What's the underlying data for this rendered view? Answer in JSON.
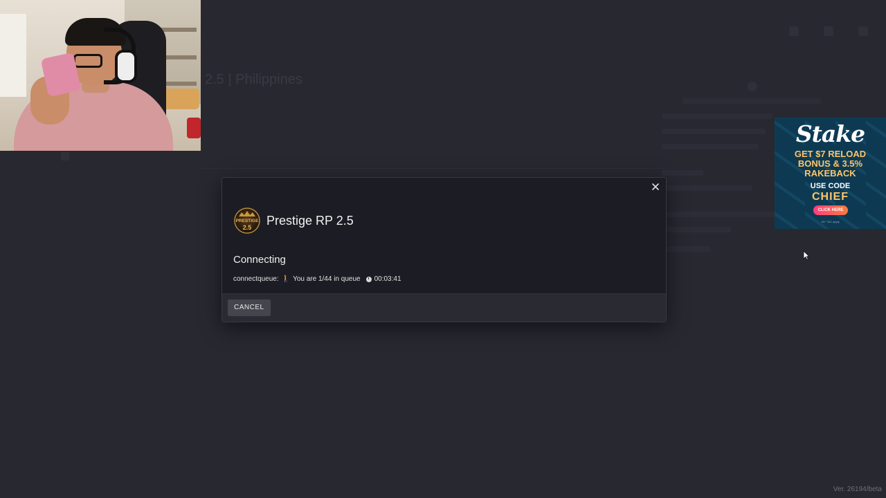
{
  "background": {
    "server_title": "2.5 | Philippines"
  },
  "modal": {
    "server_name": "Prestige RP 2.5",
    "logo_text_top": "PRESTIGE",
    "logo_text_bottom": "2.5",
    "status_title": "Connecting",
    "queue": {
      "prefix": "connectqueue:",
      "emoji": "🚶",
      "message": "You are 1/44 in queue",
      "elapsed": "00:03:41"
    },
    "cancel_label": "CANCEL"
  },
  "ad": {
    "brand": "Stake",
    "line1": "GET $7 RELOAD",
    "line2": "BONUS & 3.5%",
    "line3": "RAKEBACK",
    "code_label": "USE CODE",
    "code": "CHIEF",
    "cta": "CLICK HERE",
    "fine": "18+ T&C apply"
  },
  "footer": {
    "version": "Ver. 26194/beta"
  },
  "colors": {
    "background": "#26262f",
    "modal": "#1c1c24",
    "modal_footer": "#2a2a33",
    "button": "#45454e",
    "ad_background": "#0d3a52",
    "ad_accent": "#ffc56a"
  },
  "icons": {
    "close": "close-icon",
    "clock": "clock-icon",
    "cursor": "mouse-cursor-icon"
  }
}
